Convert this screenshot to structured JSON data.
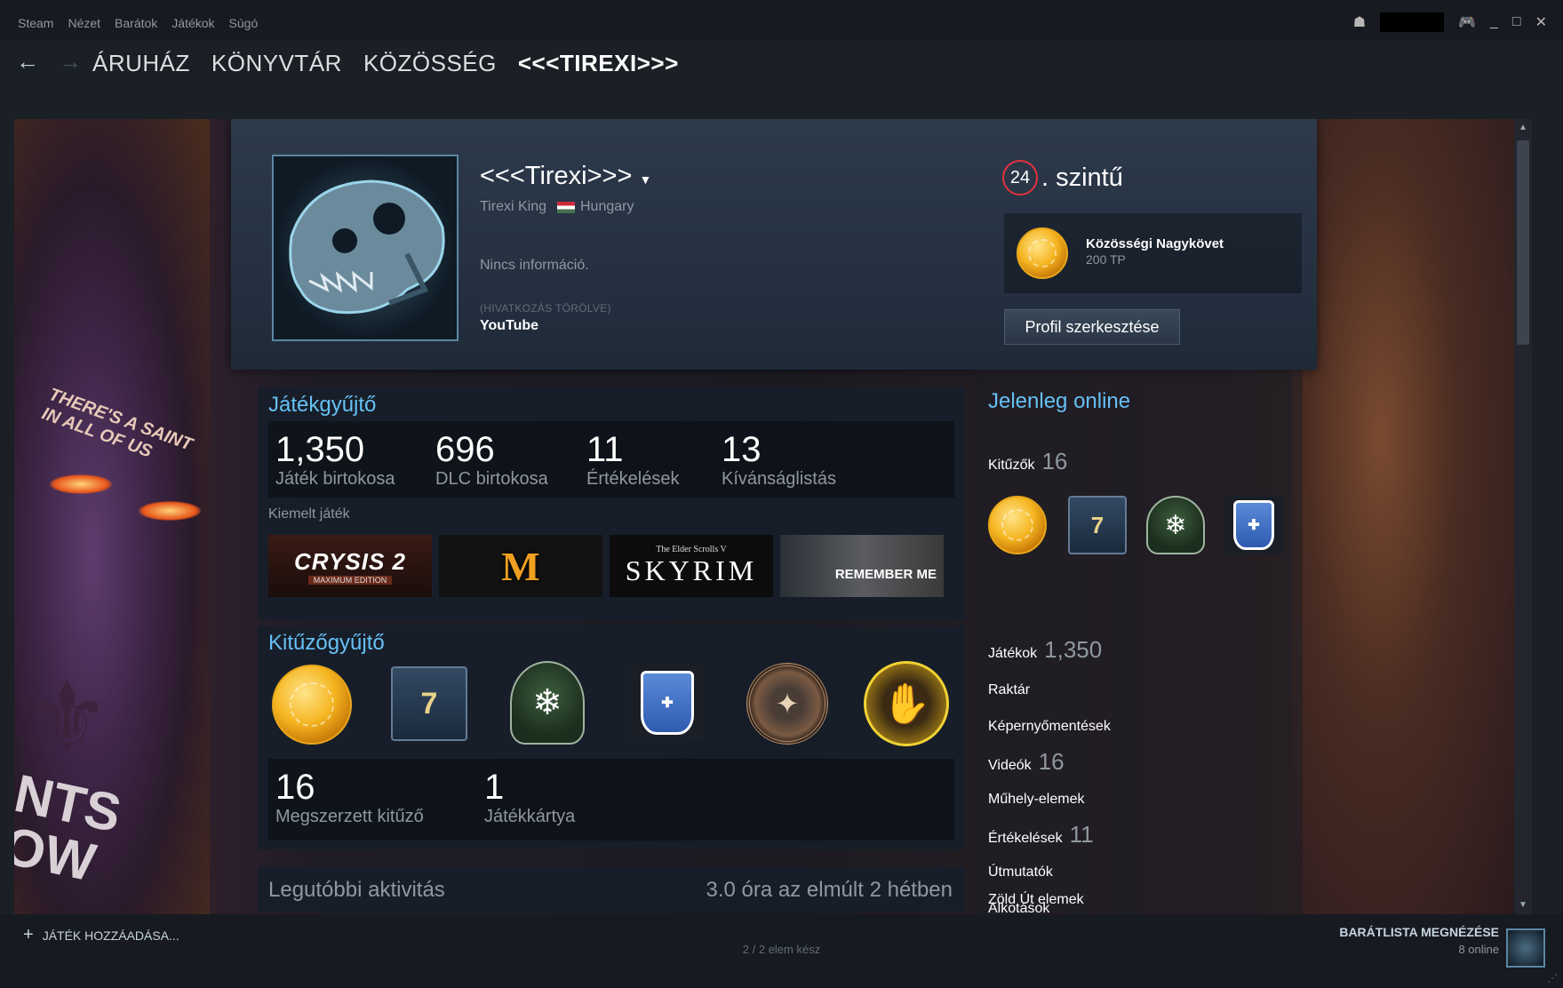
{
  "menu": [
    "Steam",
    "Nézet",
    "Barátok",
    "Játékok",
    "Súgó"
  ],
  "nav": {
    "back": "←",
    "forward": "→",
    "store": "ÁRUHÁZ",
    "library": "KÖNYVTÁR",
    "community": "KÖZÖSSÉG",
    "profile": "<<<TIREXI>>>"
  },
  "window": {
    "minimize": "_",
    "maximize": "□",
    "close": "✕"
  },
  "profile": {
    "persona_name": "<<<Tirexi>>>",
    "real_name": "Tirexi King",
    "country": "Hungary",
    "summary": "Nincs információ.",
    "link_removed": "(HIVATKOZÁS TÖRÖLVE)",
    "link_name": "YouTube",
    "level": "24",
    "level_suffix": ". szintű",
    "favorite_badge_name": "Közösségi Nagykövet",
    "favorite_badge_xp": "200 TP",
    "edit_button": "Profil szerkesztése"
  },
  "game_showcase": {
    "title": "Játékgyűjtő",
    "stats": [
      {
        "value": "1,350",
        "label": "Játék birtokosa"
      },
      {
        "value": "696",
        "label": "DLC birtokosa"
      },
      {
        "value": "11",
        "label": "Értékelések"
      },
      {
        "value": "13",
        "label": "Kívánságlistás"
      }
    ],
    "featured_label": "Kiemelt játék",
    "games": [
      {
        "title": "CRYSIS 2",
        "subtitle": "MAXIMUM EDITION"
      },
      {
        "title": "M"
      },
      {
        "title": "SKYRIM",
        "subtitle": "The Elder Scrolls V"
      },
      {
        "title": "REMEMBER ME"
      }
    ]
  },
  "badge_showcase": {
    "title": "Kitűzőgyűjtő",
    "badges": [
      "community-ambassador-icon",
      "seven-icon",
      "snow-globe-icon",
      "shield-badge-icon",
      "wreath-badge-icon",
      "hand-badge-icon"
    ],
    "stats": [
      {
        "value": "16",
        "label": "Megszerzett kitűző"
      },
      {
        "value": "1",
        "label": "Játékkártya"
      }
    ]
  },
  "activity": {
    "title": "Legutóbbi aktivitás",
    "hours": "3.0 óra az elmúlt 2 hétben"
  },
  "sidebar": {
    "online_status": "Jelenleg online",
    "badges_label": "Kitűzők",
    "badges_count": "16",
    "games_label": "Játékok",
    "games_count": "1,350",
    "inventory": "Raktár",
    "screenshots": "Képernyőmentések",
    "videos_label": "Videók",
    "videos_count": "16",
    "workshop": "Műhely-elemek",
    "reviews_label": "Értékelések",
    "reviews_count": "11",
    "guides": "Útmutatók",
    "artwork": "Alkotások",
    "greenlight": "Zöld Út elemek"
  },
  "background": {
    "slogan": "THERE'S A SAINT IN ALL OF US",
    "saints_text": "NTS\nOW"
  },
  "footer": {
    "add_game": "JÁTÉK HOZZÁADÁSA...",
    "download_status": "2 / 2 elem kész",
    "friends_list": "BARÁTLISTA MEGNÉZÉSE",
    "friends_online": "8 online"
  },
  "colors": {
    "accent": "#66c0f4",
    "level_ring": "#e3323d",
    "background": "#171a21"
  }
}
